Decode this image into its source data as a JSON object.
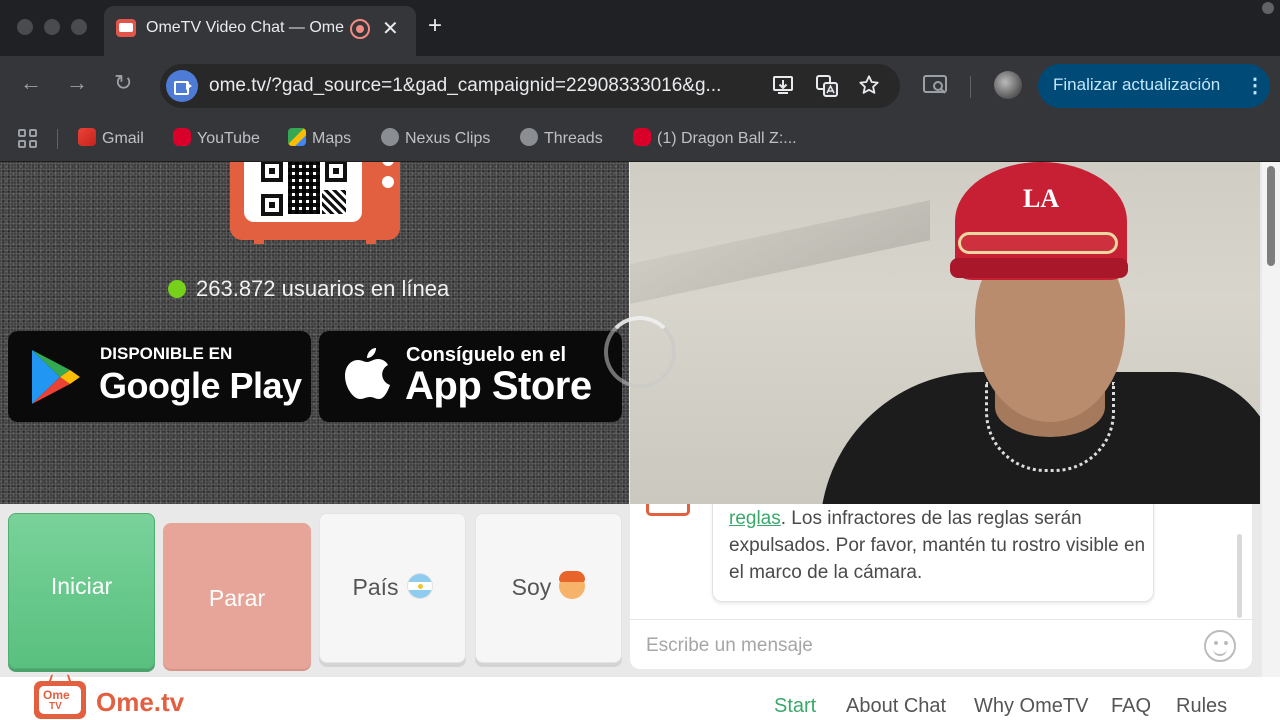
{
  "browser": {
    "tab": {
      "title": "OmeTV Video Chat — Ome",
      "close": "✕"
    },
    "new_tab": "+",
    "nav": {
      "back": "←",
      "forward": "→",
      "reload": "↻"
    },
    "url": "ome.tv/?gad_source=1&gad_campaignid=22908333016&g...",
    "update_button": "Finalizar actualización",
    "more": "⋮",
    "bookmarks": [
      {
        "label": "Gmail",
        "icon": "gmail-icon",
        "color": "#ea4335"
      },
      {
        "label": "YouTube",
        "icon": "youtube-icon",
        "color": "#ff0033"
      },
      {
        "label": "Maps",
        "icon": "maps-icon",
        "color": "#34a853"
      },
      {
        "label": "Nexus Clips",
        "icon": "globe-icon",
        "color": "#9aa0a6"
      },
      {
        "label": "Threads",
        "icon": "globe-icon",
        "color": "#9aa0a6"
      },
      {
        "label": "(1) Dragon Ball Z:...",
        "icon": "youtube-icon",
        "color": "#ff0033"
      }
    ]
  },
  "page": {
    "online_count": "263.872 usuarios en línea",
    "google_play": {
      "small": "DISPONIBLE EN",
      "big": "Google Play"
    },
    "app_store": {
      "small": "Consíguelo en el",
      "big": "App Store"
    },
    "video_cap_text": "LA",
    "controls": {
      "start": "Iniciar",
      "stop": "Parar",
      "country": "País",
      "gender": "Soy"
    },
    "chat": {
      "message_link": "reglas",
      "message_rest": ". Los infractores de las reglas serán expulsados. Por favor, mantén tu rostro visible en el marco de la cámara.",
      "input_placeholder": "Escribe un mensaje"
    },
    "footer": {
      "logo_line1": "Ome",
      "logo_line2": "TV",
      "brand": "Ome.tv",
      "nav": [
        "Start",
        "About Chat",
        "Why OmeTV",
        "FAQ",
        "Rules"
      ]
    },
    "colors": {
      "accent_green": "#3aa869",
      "brand_orange": "#e2603f",
      "online_dot": "#77d11a"
    }
  }
}
